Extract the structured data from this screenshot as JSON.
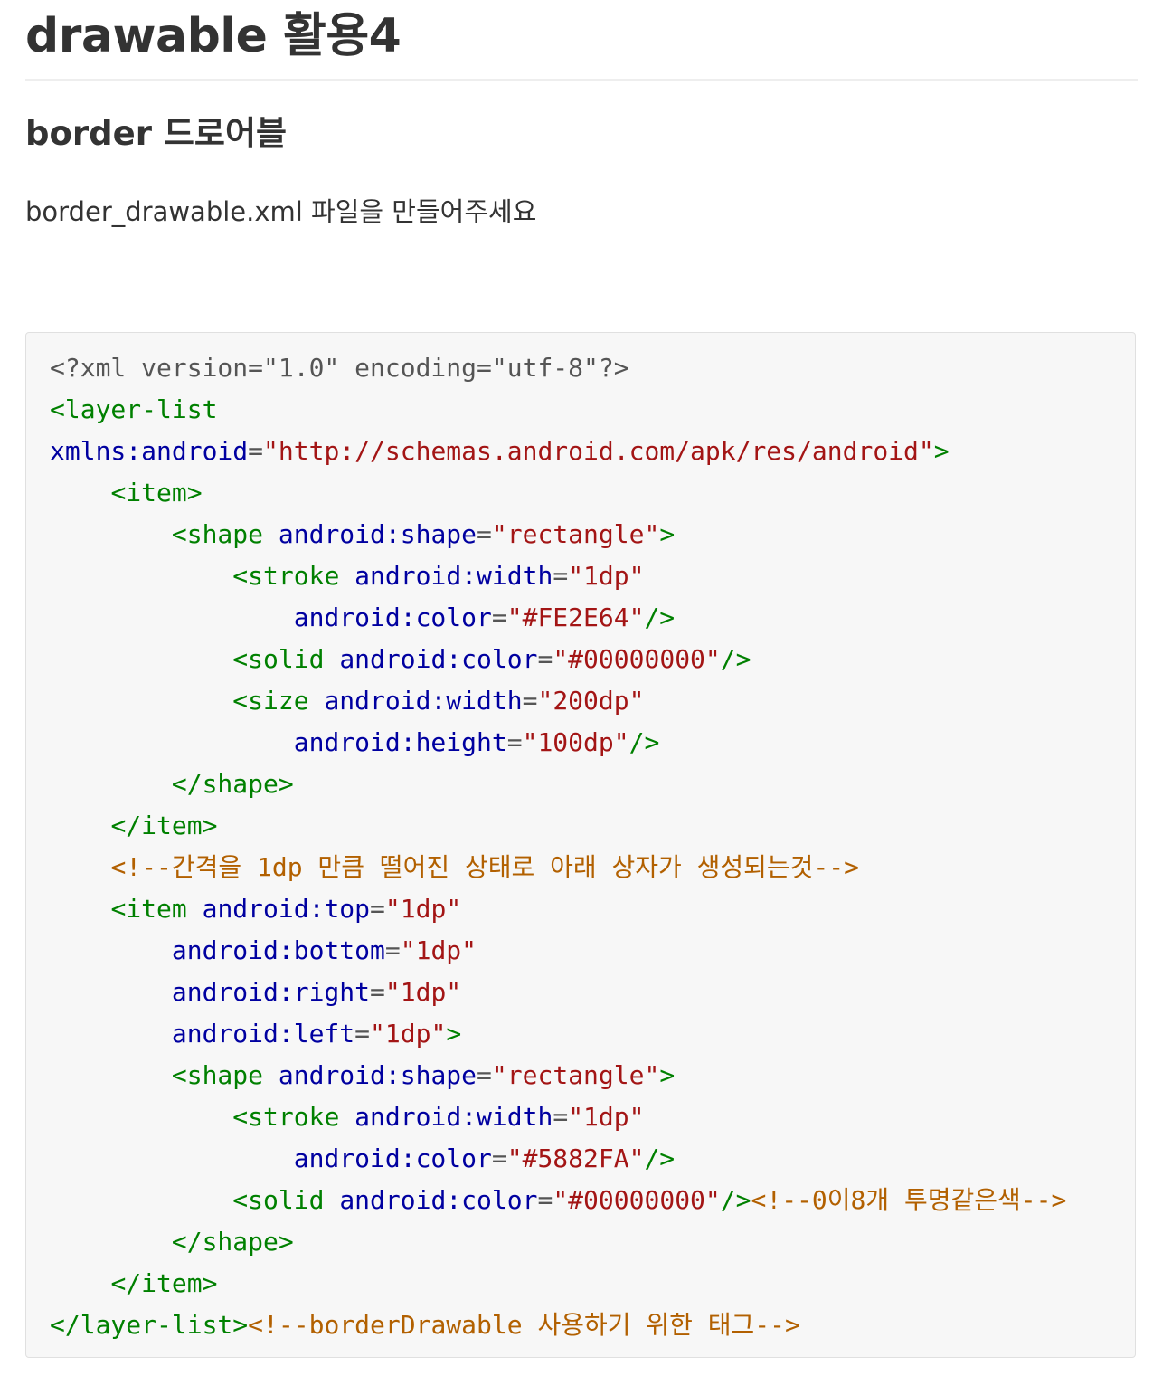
{
  "heading": "drawable 활용4",
  "subheading": "border 드로어블",
  "description": "border_drawable.xml 파일을 만들어주세요",
  "colors": {
    "tag": "#008000",
    "attribute": "#0000a0",
    "value": "#a31515",
    "comment": "#b26000",
    "code_background": "#f7f7f7"
  },
  "code_lines": [
    [
      {
        "t": "p",
        "s": "<?xml version=\"1.0\" encoding=\"utf-8\"?>"
      }
    ],
    [
      {
        "t": "g",
        "s": "<layer-list"
      }
    ],
    [
      {
        "t": "b",
        "s": "xmlns:android"
      },
      {
        "t": "p",
        "s": "="
      },
      {
        "t": "r",
        "s": "\"http://schemas.android.com/apk/res/android\""
      },
      {
        "t": "g",
        "s": ">"
      }
    ],
    [
      {
        "t": "p",
        "s": "    "
      },
      {
        "t": "g",
        "s": "<item>"
      }
    ],
    [
      {
        "t": "p",
        "s": "        "
      },
      {
        "t": "g",
        "s": "<shape"
      },
      {
        "t": "p",
        "s": " "
      },
      {
        "t": "b",
        "s": "android:shape"
      },
      {
        "t": "p",
        "s": "="
      },
      {
        "t": "r",
        "s": "\"rectangle\""
      },
      {
        "t": "g",
        "s": ">"
      }
    ],
    [
      {
        "t": "p",
        "s": "            "
      },
      {
        "t": "g",
        "s": "<stroke"
      },
      {
        "t": "p",
        "s": " "
      },
      {
        "t": "b",
        "s": "android:width"
      },
      {
        "t": "p",
        "s": "="
      },
      {
        "t": "r",
        "s": "\"1dp\""
      }
    ],
    [
      {
        "t": "p",
        "s": "                "
      },
      {
        "t": "b",
        "s": "android:color"
      },
      {
        "t": "p",
        "s": "="
      },
      {
        "t": "r",
        "s": "\"#FE2E64\""
      },
      {
        "t": "g",
        "s": "/>"
      }
    ],
    [
      {
        "t": "p",
        "s": "            "
      },
      {
        "t": "g",
        "s": "<solid"
      },
      {
        "t": "p",
        "s": " "
      },
      {
        "t": "b",
        "s": "android:color"
      },
      {
        "t": "p",
        "s": "="
      },
      {
        "t": "r",
        "s": "\"#00000000\""
      },
      {
        "t": "g",
        "s": "/>"
      }
    ],
    [
      {
        "t": "p",
        "s": "            "
      },
      {
        "t": "g",
        "s": "<size"
      },
      {
        "t": "p",
        "s": " "
      },
      {
        "t": "b",
        "s": "android:width"
      },
      {
        "t": "p",
        "s": "="
      },
      {
        "t": "r",
        "s": "\"200dp\""
      }
    ],
    [
      {
        "t": "p",
        "s": "                "
      },
      {
        "t": "b",
        "s": "android:height"
      },
      {
        "t": "p",
        "s": "="
      },
      {
        "t": "r",
        "s": "\"100dp\""
      },
      {
        "t": "g",
        "s": "/>"
      }
    ],
    [
      {
        "t": "p",
        "s": "        "
      },
      {
        "t": "g",
        "s": "</shape>"
      }
    ],
    [
      {
        "t": "p",
        "s": "    "
      },
      {
        "t": "g",
        "s": "</item>"
      }
    ],
    [
      {
        "t": "p",
        "s": "    "
      },
      {
        "t": "c",
        "s": "<!--간격을 1dp 만큼 떨어진 상태로 아래 상자가 생성되는것-->"
      }
    ],
    [
      {
        "t": "p",
        "s": "    "
      },
      {
        "t": "g",
        "s": "<item"
      },
      {
        "t": "p",
        "s": " "
      },
      {
        "t": "b",
        "s": "android:top"
      },
      {
        "t": "p",
        "s": "="
      },
      {
        "t": "r",
        "s": "\"1dp\""
      }
    ],
    [
      {
        "t": "p",
        "s": "        "
      },
      {
        "t": "b",
        "s": "android:bottom"
      },
      {
        "t": "p",
        "s": "="
      },
      {
        "t": "r",
        "s": "\"1dp\""
      }
    ],
    [
      {
        "t": "p",
        "s": "        "
      },
      {
        "t": "b",
        "s": "android:right"
      },
      {
        "t": "p",
        "s": "="
      },
      {
        "t": "r",
        "s": "\"1dp\""
      }
    ],
    [
      {
        "t": "p",
        "s": "        "
      },
      {
        "t": "b",
        "s": "android:left"
      },
      {
        "t": "p",
        "s": "="
      },
      {
        "t": "r",
        "s": "\"1dp\""
      },
      {
        "t": "g",
        "s": ">"
      }
    ],
    [
      {
        "t": "p",
        "s": "        "
      },
      {
        "t": "g",
        "s": "<shape"
      },
      {
        "t": "p",
        "s": " "
      },
      {
        "t": "b",
        "s": "android:shape"
      },
      {
        "t": "p",
        "s": "="
      },
      {
        "t": "r",
        "s": "\"rectangle\""
      },
      {
        "t": "g",
        "s": ">"
      }
    ],
    [
      {
        "t": "p",
        "s": "            "
      },
      {
        "t": "g",
        "s": "<stroke"
      },
      {
        "t": "p",
        "s": " "
      },
      {
        "t": "b",
        "s": "android:width"
      },
      {
        "t": "p",
        "s": "="
      },
      {
        "t": "r",
        "s": "\"1dp\""
      }
    ],
    [
      {
        "t": "p",
        "s": "                "
      },
      {
        "t": "b",
        "s": "android:color"
      },
      {
        "t": "p",
        "s": "="
      },
      {
        "t": "r",
        "s": "\"#5882FA\""
      },
      {
        "t": "g",
        "s": "/>"
      }
    ],
    [
      {
        "t": "p",
        "s": "            "
      },
      {
        "t": "g",
        "s": "<solid"
      },
      {
        "t": "p",
        "s": " "
      },
      {
        "t": "b",
        "s": "android:color"
      },
      {
        "t": "p",
        "s": "="
      },
      {
        "t": "r",
        "s": "\"#00000000\""
      },
      {
        "t": "g",
        "s": "/>"
      },
      {
        "t": "c",
        "s": "<!--0이8개 투명같은색-->"
      }
    ],
    [
      {
        "t": "p",
        "s": "        "
      },
      {
        "t": "g",
        "s": "</shape>"
      }
    ],
    [
      {
        "t": "p",
        "s": "    "
      },
      {
        "t": "g",
        "s": "</item>"
      }
    ],
    [
      {
        "t": "g",
        "s": "</layer-list>"
      },
      {
        "t": "c",
        "s": "<!--borderDrawable 사용하기 위한 태그-->"
      }
    ]
  ]
}
